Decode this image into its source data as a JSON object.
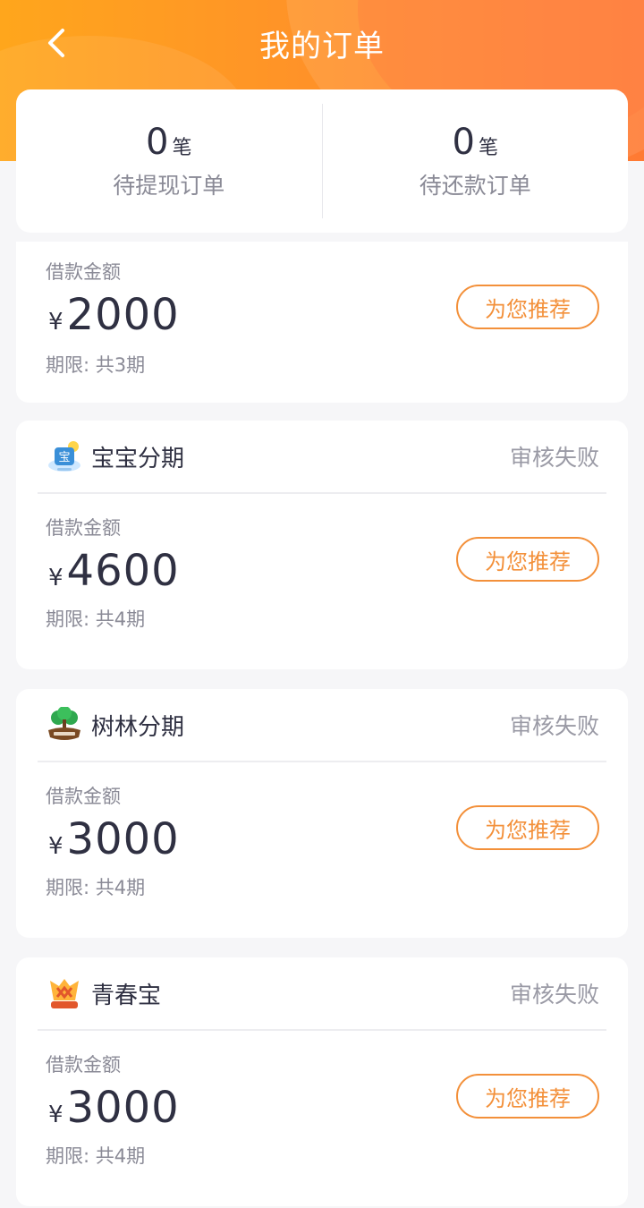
{
  "header": {
    "title": "我的订单",
    "accent": "#ff8f2a"
  },
  "summary": {
    "withdraw": {
      "count": "0",
      "unit": "笔",
      "label": "待提现订单"
    },
    "repay": {
      "count": "0",
      "unit": "笔",
      "label": "待还款订单"
    }
  },
  "orders": [
    {
      "amount_label": "借款金额",
      "currency": "¥",
      "amount": "2000",
      "term": "期限: 共3期",
      "button": "为您推荐"
    },
    {
      "app_name": "宝宝分期",
      "status": "审核失败",
      "logo_icon": "baby-app-logo-icon",
      "amount_label": "借款金额",
      "currency": "¥",
      "amount": "4600",
      "term": "期限: 共4期",
      "button": "为您推荐"
    },
    {
      "app_name": "树林分期",
      "status": "审核失败",
      "logo_icon": "tree-app-logo-icon",
      "amount_label": "借款金额",
      "currency": "¥",
      "amount": "3000",
      "term": "期限: 共4期",
      "button": "为您推荐"
    },
    {
      "app_name": "青春宝",
      "status": "审核失败",
      "logo_icon": "youth-app-logo-icon",
      "amount_label": "借款金额",
      "currency": "¥",
      "amount": "3000",
      "term": "期限: 共4期",
      "button": "为您推荐"
    }
  ],
  "colors": {
    "button_orange": "#f3903a",
    "status_gray": "#9a9aa5",
    "text_dark": "#2f3042"
  }
}
